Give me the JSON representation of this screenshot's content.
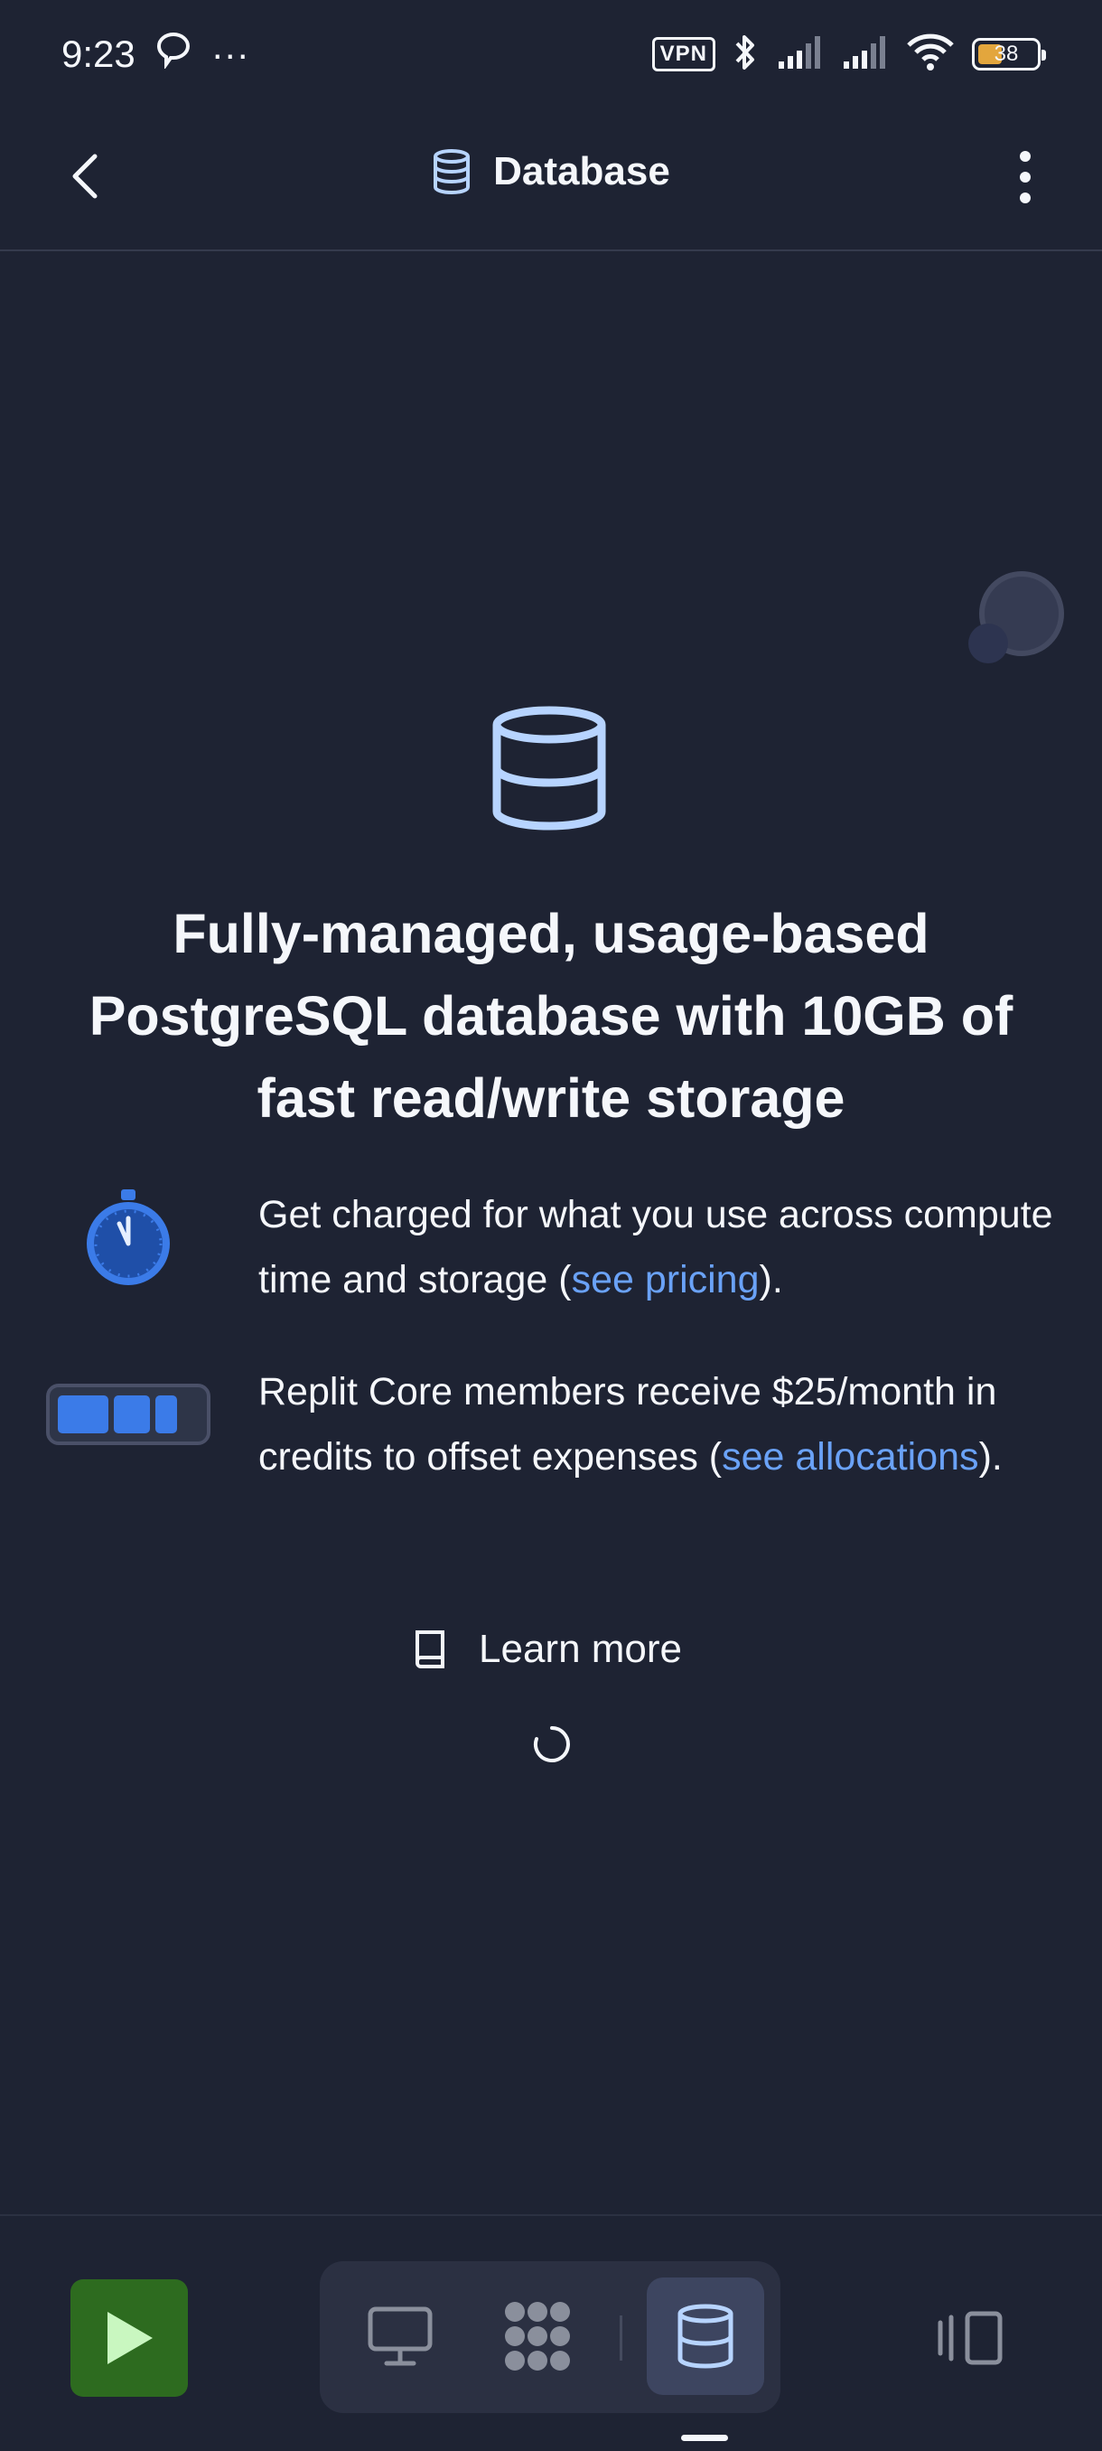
{
  "status_bar": {
    "time": "9:23",
    "more": "···",
    "vpn": "VPN",
    "battery_level": "38",
    "icons": [
      "chat-bubble-icon",
      "bluetooth-icon",
      "signal-icon",
      "signal-icon",
      "wifi-icon",
      "battery-icon"
    ]
  },
  "header": {
    "title": "Database",
    "icons": [
      "back-arrow-icon",
      "database-icon",
      "more-vertical-icon"
    ]
  },
  "main": {
    "headline": "Fully-managed, usage-based PostgreSQL database with 10GB of fast read/write storage",
    "feature_1": {
      "text_before": "Get charged for what you use across compute time and storage (",
      "link": "see pricing",
      "text_after": ").",
      "icon": "stopwatch-icon"
    },
    "feature_2": {
      "text_before": "Replit Core members receive $25/month in credits to offset expenses (",
      "link": "see allocations",
      "text_after": ").",
      "icon": "battery-credits-icon"
    },
    "learn_more": "Learn more"
  },
  "bottom_bar": {
    "icons": [
      "play-icon",
      "monitor-icon",
      "workflows-icon",
      "database-icon",
      "panes-icon"
    ],
    "selected_tool": "database"
  },
  "colors": {
    "background": "#1e2333",
    "accent_link": "#6aa2f7",
    "run_button": "#2d6b1f",
    "icon_blue": "#b7d4ff"
  }
}
